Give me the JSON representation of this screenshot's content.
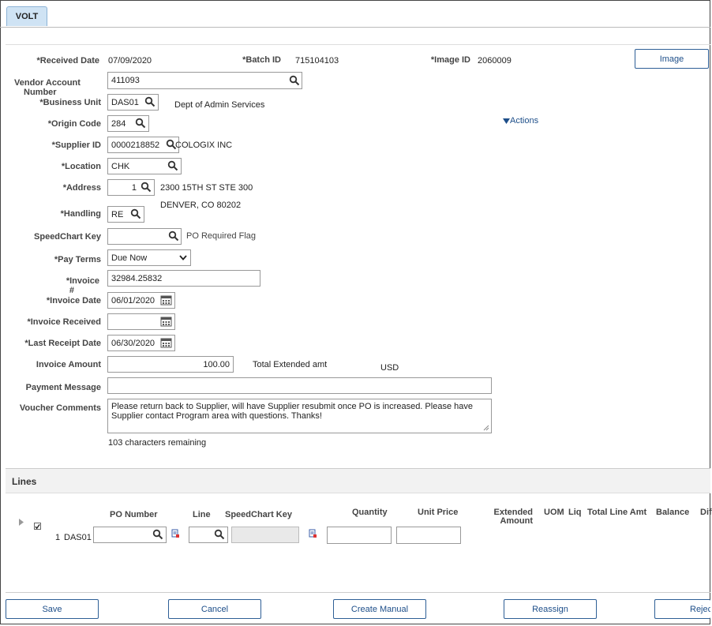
{
  "tab": {
    "label": "VOLT"
  },
  "header": {
    "received_date_label": "*Received Date",
    "received_date": "07/09/2020",
    "batch_id_label": "*Batch ID",
    "batch_id": "715104103",
    "image_id_label": "*Image ID",
    "image_id": "2060009",
    "image_button": "Image"
  },
  "form": {
    "vendor_account_label_1": "Vendor Account",
    "vendor_account_label_2": "Number",
    "vendor_account": "411093",
    "business_unit_label": "*Business Unit",
    "business_unit": "DAS01",
    "business_unit_desc": "Dept of Admin Services",
    "origin_code_label": "*Origin Code",
    "origin_code": "284",
    "actions_link": "Actions",
    "supplier_id_label": "*Supplier ID",
    "supplier_id": "0000218852",
    "supplier_name": "COLOGIX INC",
    "location_label": "*Location",
    "location": "CHK",
    "address_label": "*Address",
    "address": "1",
    "address_line1": "2300 15TH ST STE 300",
    "address_line2": "DENVER, CO  80202",
    "handling_label": "*Handling",
    "handling": "RE",
    "speedchart_label": "SpeedChart Key",
    "speedchart": "",
    "po_required_flag": "PO Required Flag",
    "pay_terms_label": "*Pay Terms",
    "pay_terms": "Due Now",
    "invoice_label_1": "*Invoice",
    "invoice_label_2": "#",
    "invoice_number": "32984.25832",
    "invoice_date_label": "*Invoice Date",
    "invoice_date": "06/01/2020",
    "invoice_received_label": "*Invoice Received",
    "invoice_received": "",
    "last_receipt_label": "*Last Receipt Date",
    "last_receipt": "06/30/2020",
    "invoice_amount_label": "Invoice Amount",
    "invoice_amount": "100.00",
    "total_extended_label": "Total Extended amt",
    "currency": "USD",
    "payment_message_label": "Payment Message",
    "payment_message": "",
    "voucher_comments_label": "Voucher Comments",
    "voucher_comments": "Please return back to Supplier, will have Supplier resubmit once PO is increased. Please have Supplier contact Program area with questions. Thanks!",
    "chars_remaining": "103 characters remaining"
  },
  "lines": {
    "title": "Lines",
    "columns": {
      "po_number": "PO Number",
      "line": "Line",
      "speedchart": "SpeedChart Key",
      "quantity": "Quantity",
      "unit_price": "Unit Price",
      "extended_1": "Extended",
      "extended_2": "Amount",
      "uom": "UOM",
      "liq": "Liq",
      "total_line_amt": "Total Line Amt",
      "balance": "Balance",
      "diff": "Dif"
    },
    "row": {
      "num": "1",
      "bu": "DAS01",
      "checked": true
    }
  },
  "footer": {
    "save": "Save",
    "cancel": "Cancel",
    "create_manual": "Create Manual",
    "reassign": "Reassign",
    "reject": "Reject"
  },
  "icons": {
    "lookup": "magnifier-icon",
    "calendar": "calendar-icon",
    "related": "related-content-icon",
    "expand": "triangle-right-icon",
    "actions": "triangle-down-icon"
  }
}
